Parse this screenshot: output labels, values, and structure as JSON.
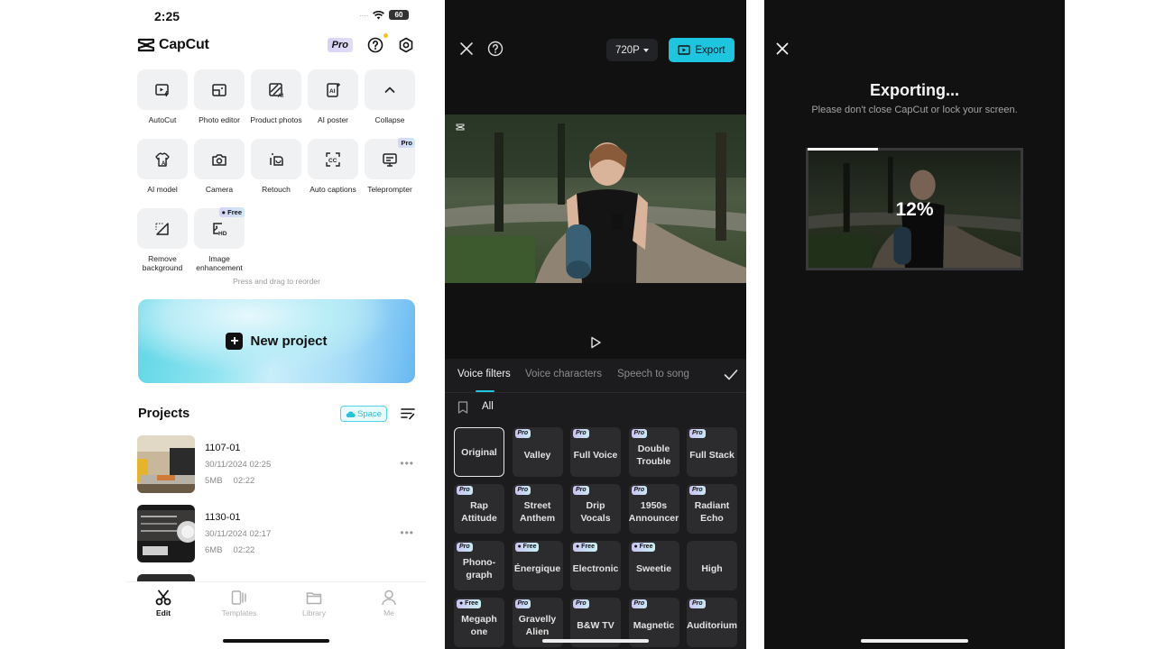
{
  "home": {
    "status": {
      "time": "2:25",
      "battery": "60"
    },
    "brand": "CapCut",
    "header": {
      "pro_label": "Pro"
    },
    "tools": [
      {
        "label": "AutoCut",
        "icon": "autocut-icon",
        "badge": null
      },
      {
        "label": "Photo editor",
        "icon": "photo-editor-icon",
        "badge": null
      },
      {
        "label": "Product photos",
        "icon": "product-photos-icon",
        "badge": null
      },
      {
        "label": "AI poster",
        "icon": "ai-poster-icon",
        "badge": null
      },
      {
        "label": "Collapse",
        "icon": "chevron-up-icon",
        "badge": null
      },
      {
        "label": "AI model",
        "icon": "ai-model-icon",
        "badge": null
      },
      {
        "label": "Camera",
        "icon": "camera-icon",
        "badge": null
      },
      {
        "label": "Retouch",
        "icon": "retouch-icon",
        "badge": null
      },
      {
        "label": "Auto captions",
        "icon": "auto-captions-icon",
        "badge": null
      },
      {
        "label": "Teleprompter",
        "icon": "teleprompter-icon",
        "badge": "Pro"
      },
      {
        "label": "Remove\nbackground",
        "label_line1": "Remove",
        "label_line2": "background",
        "icon": "remove-background-icon",
        "badge": null
      },
      {
        "label": "Image\nenhancement",
        "label_line1": "Image",
        "label_line2": "enhancement",
        "icon": "image-enhancement-icon",
        "badge": "Free"
      }
    ],
    "reorder_hint": "Press and drag to reorder",
    "new_project_label": "New project",
    "projects": {
      "title": "Projects",
      "space_label": "Space",
      "items": [
        {
          "name": "1107-01",
          "date": "30/11/2024 02:25",
          "size": "5MB",
          "duration": "02:22"
        },
        {
          "name": "1130-01",
          "date": "30/11/2024 02:17",
          "size": "6MB",
          "duration": "02:22"
        }
      ]
    },
    "tabbar": [
      {
        "label": "Edit",
        "icon": "scissors-icon",
        "active": true
      },
      {
        "label": "Templates",
        "icon": "templates-icon",
        "active": false
      },
      {
        "label": "Library",
        "icon": "folder-icon",
        "active": false
      },
      {
        "label": "Me",
        "icon": "person-icon",
        "active": false
      }
    ]
  },
  "editor": {
    "resolution": "720P",
    "export_label": "Export",
    "tabs": [
      {
        "label": "Voice filters",
        "active": true
      },
      {
        "label": "Voice characters",
        "active": false
      },
      {
        "label": "Speech to song",
        "active": false
      }
    ],
    "category": "All",
    "filters": [
      {
        "label": "Original",
        "badge": null,
        "selected": true
      },
      {
        "label": "Valley",
        "badge": "Pro"
      },
      {
        "label": "Full Voice",
        "badge": "Pro"
      },
      {
        "label": "Double Trouble",
        "badge": "Pro"
      },
      {
        "label": "Full Stack",
        "badge": "Pro"
      },
      {
        "label": "Rap Attitude",
        "badge": "Pro"
      },
      {
        "label": "Street Anthem",
        "badge": "Pro"
      },
      {
        "label": "Drip Vocals",
        "badge": "Pro"
      },
      {
        "label": "1950s Announcer",
        "badge": "Pro"
      },
      {
        "label": "Radiant Echo",
        "badge": "Pro"
      },
      {
        "label": "Phono-graph",
        "badge": "Pro"
      },
      {
        "label": "Énergique",
        "badge": "Free"
      },
      {
        "label": "Electronic",
        "badge": "Free"
      },
      {
        "label": "Sweetie",
        "badge": "Free"
      },
      {
        "label": "High",
        "badge": null
      },
      {
        "label": "Megaph one",
        "badge": "Free"
      },
      {
        "label": "Gravelly Alien",
        "badge": "Pro"
      },
      {
        "label": "B&W TV",
        "badge": "Pro"
      },
      {
        "label": "Magnetic",
        "badge": "Pro"
      },
      {
        "label": "Auditorium",
        "badge": "Pro"
      }
    ]
  },
  "exporting": {
    "title": "Exporting...",
    "subtitle": "Please don't close CapCut or lock your screen.",
    "progress_percent": 12,
    "progress_label": "12%"
  },
  "colors": {
    "accent": "#1ec5df",
    "dark_bg": "#111112",
    "sheet_bg": "#1c1c1e",
    "tile_bg": "#2c2c2e"
  }
}
